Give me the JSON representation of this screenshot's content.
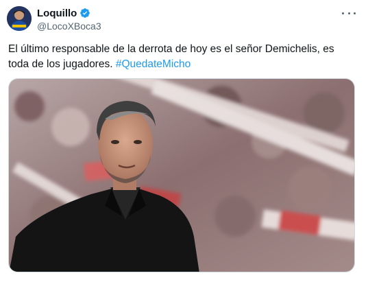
{
  "author": {
    "display_name": "Loquillo",
    "handle": "@LocoXBoca3",
    "verified": true,
    "avatar_icon": "avatar-icon"
  },
  "tweet": {
    "text_main": "El último responsable de la derrota de hoy es el señor Demichelis, es toda de los jugadores. ",
    "hashtag": "#QuedateMicho"
  },
  "more_icon": "more-options-icon",
  "colors": {
    "accent": "#1d9bf0",
    "text": "#0f1419",
    "secondary": "#536471"
  }
}
